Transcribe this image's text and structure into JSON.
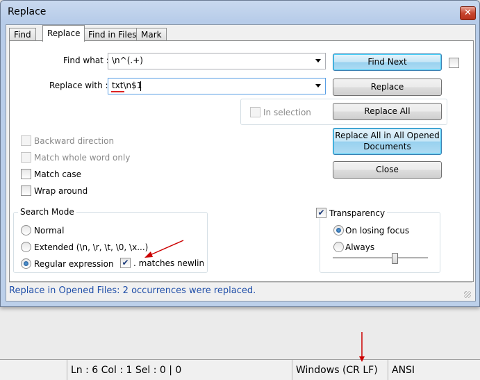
{
  "window": {
    "title": "Replace",
    "close_label": "✕"
  },
  "tabs": [
    {
      "label": "Find"
    },
    {
      "label": "Replace"
    },
    {
      "label": "Find in Files"
    },
    {
      "label": "Mark"
    }
  ],
  "form": {
    "find_label": "Find what :",
    "find_value": "\\n^(.+)",
    "replace_label": "Replace with :",
    "replace_value": "txt\\n$1",
    "in_selection_label": "In selection"
  },
  "buttons": {
    "find_next": "Find Next",
    "replace": "Replace",
    "replace_all": "Replace All",
    "replace_all_opened_line1": "Replace All in All Opened",
    "replace_all_opened_line2": "Documents",
    "close": "Close"
  },
  "options": {
    "backward": "Backward direction",
    "whole_word": "Match whole word only",
    "match_case": "Match case",
    "wrap_around": "Wrap around"
  },
  "search_mode": {
    "title": "Search Mode",
    "normal": "Normal",
    "extended": "Extended (\\n, \\r, \\t, \\0, \\x...)",
    "regex": "Regular expression",
    "matches_newline": ". matches newline"
  },
  "transparency": {
    "title": "Transparency",
    "on_losing_focus": "On losing focus",
    "always": "Always",
    "level": 0.65
  },
  "status_message": "Replace in Opened Files: 2 occurrences were replaced.",
  "app_status": {
    "position": "Ln : 6    Col : 1    Sel : 0 | 0",
    "eol": "Windows (CR LF)",
    "encoding": "ANSI"
  },
  "colors": {
    "status_text": "#1f4ea8",
    "annotation_arrow": "#cc0000"
  }
}
